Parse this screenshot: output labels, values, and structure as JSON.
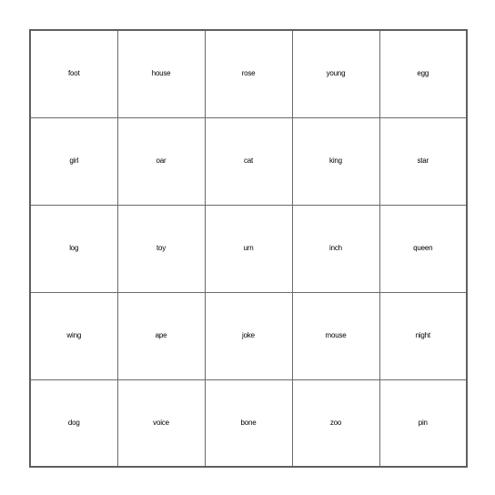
{
  "card": {
    "type": "bingo-card",
    "grid_size": "5x5",
    "border_color": "#5f5f5f",
    "grid_line_color": "#6b6b6b",
    "text_color": "#000000",
    "background_color": "#ffffff",
    "rows": [
      [
        {
          "word": "foot",
          "size": "fs-xl"
        },
        {
          "word": "house",
          "size": "fs-sm"
        },
        {
          "word": "rose",
          "size": "fs-xl"
        },
        {
          "word": "young",
          "size": "fs-md"
        },
        {
          "word": "egg",
          "size": "fs-xl"
        }
      ],
      [
        {
          "word": "girl",
          "size": "fs-xl"
        },
        {
          "word": "oar",
          "size": "fs-xl"
        },
        {
          "word": "cat",
          "size": "fs-xl"
        },
        {
          "word": "king",
          "size": "fs-xl"
        },
        {
          "word": "star",
          "size": "fs-xl"
        }
      ],
      [
        {
          "word": "log",
          "size": "fs-xl"
        },
        {
          "word": "toy",
          "size": "fs-xl"
        },
        {
          "word": "urn",
          "size": "fs-xl"
        },
        {
          "word": "inch",
          "size": "fs-lg"
        },
        {
          "word": "queen",
          "size": "fs-md"
        }
      ],
      [
        {
          "word": "wing",
          "size": "fs-lg"
        },
        {
          "word": "ape",
          "size": "fs-xl"
        },
        {
          "word": "joke",
          "size": "fs-lg"
        },
        {
          "word": "mouse",
          "size": "fs-sm"
        },
        {
          "word": "night",
          "size": "fs-lg"
        }
      ],
      [
        {
          "word": "dog",
          "size": "fs-xl"
        },
        {
          "word": "voice",
          "size": "fs-md"
        },
        {
          "word": "bone",
          "size": "fs-lg"
        },
        {
          "word": "zoo",
          "size": "fs-xl"
        },
        {
          "word": "pin",
          "size": "fs-xl"
        }
      ]
    ]
  }
}
